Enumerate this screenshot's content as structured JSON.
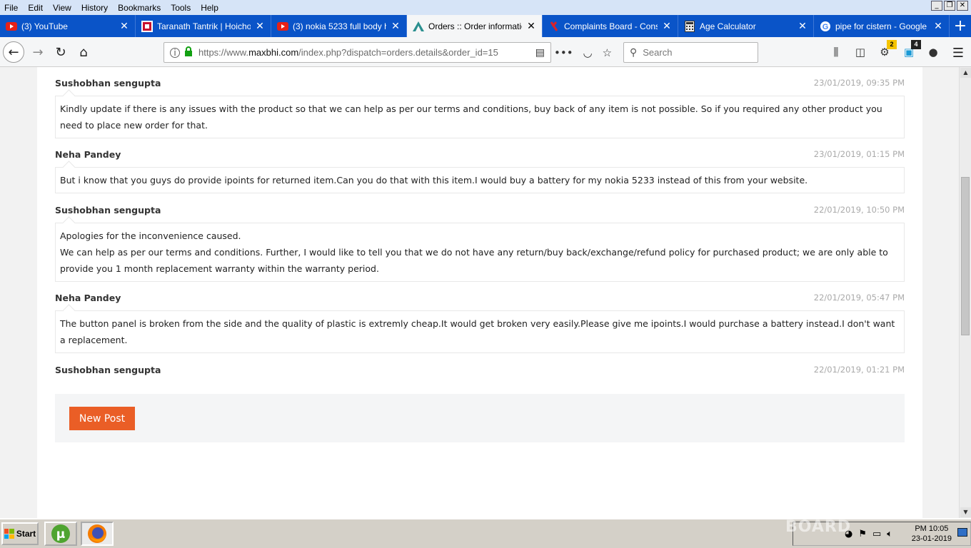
{
  "menu": {
    "items": [
      "File",
      "Edit",
      "View",
      "History",
      "Bookmarks",
      "Tools",
      "Help"
    ]
  },
  "tabs": [
    {
      "title": "(3) YouTube",
      "icon": "youtube-icon",
      "active": false
    },
    {
      "title": "Taranath Tantrik | Hoichoi",
      "icon": "hoichoi-icon",
      "active": false
    },
    {
      "title": "(3) nokia 5233 full body ho",
      "icon": "youtube-icon",
      "active": false
    },
    {
      "title": "Orders :: Order information",
      "icon": "maxbhi-icon",
      "active": true
    },
    {
      "title": "Complaints Board - Consum",
      "icon": "complaints-board-icon",
      "active": false
    },
    {
      "title": "Age Calculator",
      "icon": "calculator-icon",
      "active": false
    },
    {
      "title": "pipe for cistern - Google Se",
      "icon": "google-icon",
      "active": false
    }
  ],
  "nav": {
    "url_prefix": "https://www.",
    "url_domain": "maxbhi.com",
    "url_rest": "/index.php?dispatch=orders.details&order_id=15",
    "search_placeholder": "Search",
    "badge_notify": "2",
    "badge_ext": "4"
  },
  "posts": [
    {
      "author": "Sushobhan sengupta",
      "date": "23/01/2019, 09:35 PM",
      "lines": [
        "Kindly update if there is any issues with the product so that we can help as per our terms and conditions, buy back of any item is not possible. So if you required any other product you need to place new order for that."
      ]
    },
    {
      "author": "Neha Pandey",
      "date": "23/01/2019, 01:15 PM",
      "lines": [
        "But i know that you guys do provide ipoints for returned item.Can you do that with this item.I would buy a battery for my nokia 5233 instead of this from your website."
      ]
    },
    {
      "author": "Sushobhan sengupta",
      "date": "22/01/2019, 10:50 PM",
      "lines": [
        "Apologies for the inconvenience caused.",
        "We can help as per our terms and conditions. Further, I would like to tell you that we do not have any return/buy back/exchange/refund policy for purchased product; we are only able to provide you 1 month replacement warranty within the warranty period."
      ]
    },
    {
      "author": "Neha Pandey",
      "date": "22/01/2019, 05:47 PM",
      "lines": [
        "The button panel is broken from the side and the quality of plastic is extremly cheap.It would get broken very easily.Please give me ipoints.I would purchase a battery instead.I don't want a replacement."
      ]
    },
    {
      "author": "Sushobhan sengupta",
      "date": "22/01/2019, 01:21 PM",
      "lines": []
    }
  ],
  "new_post_label": "New Post",
  "taskbar": {
    "start_label": "Start",
    "time": "PM 10:05",
    "date": "23-01-2019",
    "watermark": "BOARD"
  },
  "colors": {
    "accent_button": "#ea5e26",
    "tabstrip": "#0a54c8"
  }
}
